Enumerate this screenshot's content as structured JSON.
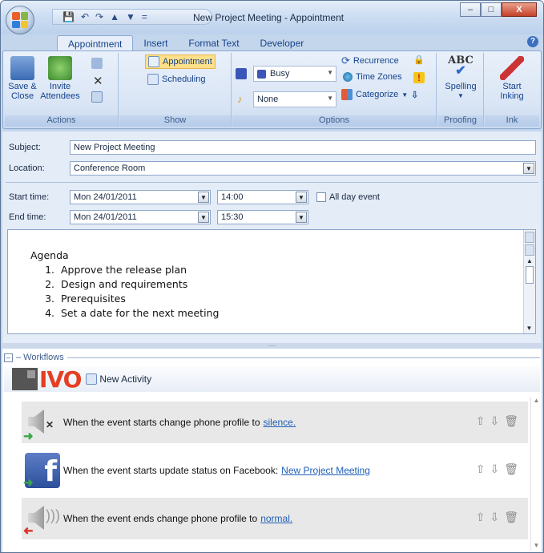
{
  "window": {
    "title": "New Project Meeting - Appointment",
    "controls": {
      "minimize": "–",
      "maximize": "□",
      "close": "X"
    }
  },
  "qat": {
    "save": "💾",
    "undo": "↶",
    "redo": "↷",
    "up": "▲",
    "down": "▼",
    "more": "="
  },
  "tabs": [
    "Appointment",
    "Insert",
    "Format Text",
    "Developer"
  ],
  "help_label": "?",
  "ribbon": {
    "actions": {
      "label": "Actions",
      "save_close": [
        "Save &",
        "Close"
      ],
      "invite": [
        "Invite",
        "Attendees"
      ],
      "delete": "✕"
    },
    "show": {
      "label": "Show",
      "appointment": "Appointment",
      "scheduling": "Scheduling"
    },
    "options": {
      "label": "Options",
      "showas": "Busy",
      "reminder": "None",
      "recurrence": "Recurrence",
      "timezones": "Time Zones",
      "categorize": "Categorize"
    },
    "proofing": {
      "label": "Proofing",
      "spelling": "Spelling",
      "abc": "ABC"
    },
    "ink": {
      "label": "Ink",
      "start": [
        "Start",
        "Inking"
      ]
    }
  },
  "form": {
    "subject_label": "Subject:",
    "subject_value": "New Project Meeting",
    "location_label": "Location:",
    "location_value": "Conference Room",
    "start_label": "Start time:",
    "start_date": "Mon 24/01/2011",
    "start_time": "14:00",
    "end_label": "End time:",
    "end_date": "Mon 24/01/2011",
    "end_time": "15:30",
    "allday_label": "All day event"
  },
  "body": {
    "heading": "Agenda",
    "items": [
      "Approve the release plan",
      "Design and requirements",
      "Prerequisites",
      "Set a date for the next meeting"
    ]
  },
  "splitter_grip": ".....",
  "workflows": {
    "collapse": "–",
    "label": "– Workflows",
    "brand": "IVO",
    "new_activity": "New Activity",
    "rows": [
      {
        "text": "When the event starts change phone profile to",
        "link": "silence."
      },
      {
        "text": "When the event starts update status on Facebook:",
        "link": "New Project Meeting"
      },
      {
        "text": "When the event ends change phone profile to",
        "link": "normal."
      }
    ]
  },
  "colors": {
    "accent": "#15428b",
    "ivo_red": "#e53e21",
    "link": "#1f5fb8",
    "ribbon": "#dbe6f4"
  }
}
